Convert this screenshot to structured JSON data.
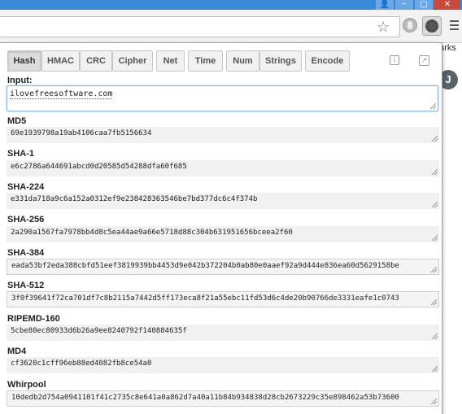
{
  "window": {
    "user_icon": "person-icon",
    "minimize": "−",
    "maximize": "▢",
    "close": "✕"
  },
  "toolbar": {
    "star": "☆",
    "bookmarks_fragment": "harks",
    "avatar_letter": "J"
  },
  "popup": {
    "tabs": [
      "Hash",
      "HMAC",
      "CRC",
      "Cipher",
      "Net",
      "Time",
      "Num",
      "Strings",
      "Encode"
    ],
    "active_tab": "Hash",
    "info_icon": "i",
    "popout_icon": "↗",
    "input_label": "Input:",
    "input_value": "ilovefreesoftware.com",
    "hashes": [
      {
        "label": "MD5",
        "value": "69e1939798a19ab4106caa7fb5156634"
      },
      {
        "label": "SHA-1",
        "value": "e6c2786a644691abcd0d20585d54288dfa60f685"
      },
      {
        "label": "SHA-224",
        "value": "e331da718a9c6a152a0312ef9e238428363546be7bd377dc6c4f374b"
      },
      {
        "label": "SHA-256",
        "value": "2a290a1567fa7978bb4d8c5ea44ae9a66e5718d88c304b631951656bceea2f60"
      },
      {
        "label": "SHA-384",
        "value": "eada53bf2eda388cbfd51eef3819939bb4453d9e042b372204b0ab80e0aaef92a9d444e836ea60d5629158be"
      },
      {
        "label": "SHA-512",
        "value": "3f0f39641f72ca701df7c8b2115a7442d5ff173eca8f21a55ebc11fd53d6c4de20b90766de3331eafe1c0743"
      },
      {
        "label": "RIPEMD-160",
        "value": "5cbe80ec80933d6b26a9ee8240792f140884635f"
      },
      {
        "label": "MD4",
        "value": "cf3620c1cff96eb88ed4082fb8ce54a0"
      },
      {
        "label": "Whirpool",
        "value": "10dedb2d754a0941101f41c2735c8e641a0a862d7a40a11b84b934838d28cb2673229c35e898462a53b73600"
      }
    ]
  },
  "colors": {
    "titlebar": "#3b8ad9",
    "close_button": "#c74a3a",
    "input_border": "#8ab3d6"
  }
}
